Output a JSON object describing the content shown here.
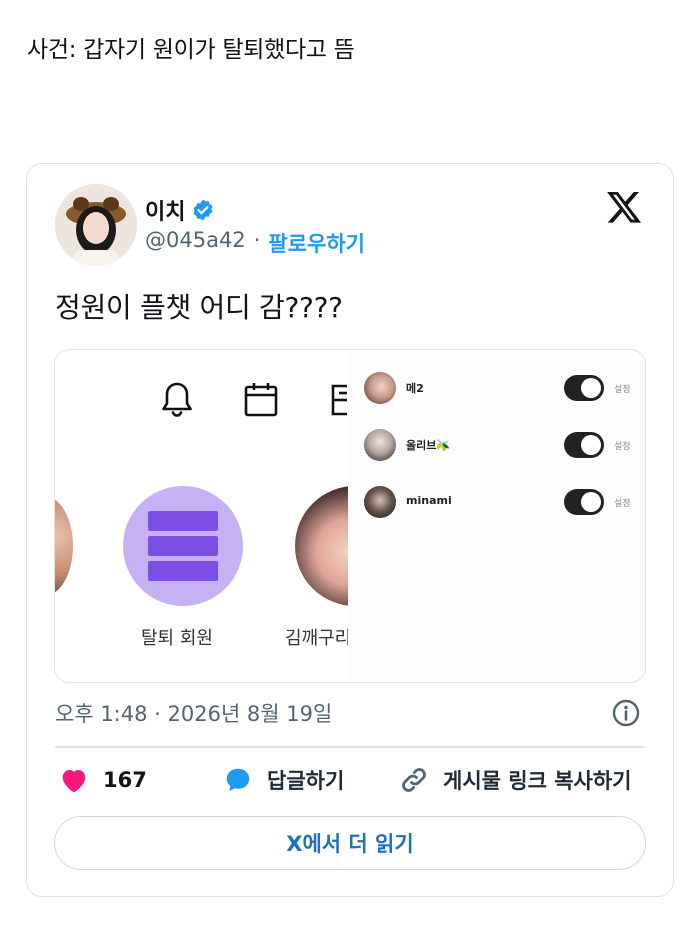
{
  "post": {
    "headline": "사건: 갑자기 원이가 탈퇴했다고 뜸"
  },
  "tweet": {
    "display_name": "이치",
    "handle": "@045a42",
    "separator": "·",
    "follow_label": "팔로우하기",
    "text": "정원이 플챗 어디 감????",
    "timestamp": "오후 1:48 · 2026년 8월 19일",
    "likes": "167",
    "reply_label": "답글하기",
    "copy_link_label": "게시물 링크 복사하기",
    "read_more_label": "X에서 더 읽기"
  },
  "screenshot_left": {
    "icons": [
      "bell-icon",
      "calendar-icon",
      "partial-icon"
    ],
    "left_label": "탈퇴 회원",
    "right_label": "김깨구리"
  },
  "screenshot_right": {
    "members": [
      {
        "name": "메2",
        "setting": "설정",
        "toggle_on": true
      },
      {
        "name": "올리브🫒",
        "setting": "설정",
        "toggle_on": true
      },
      {
        "name": "minami",
        "setting": "설정",
        "toggle_on": true
      }
    ]
  },
  "colors": {
    "accent": "#1d9bf0",
    "heart": "#f91880",
    "secondary_text": "#536471",
    "purple_circle": "#c6b1f4",
    "purple_bar": "#7b4fe3"
  }
}
